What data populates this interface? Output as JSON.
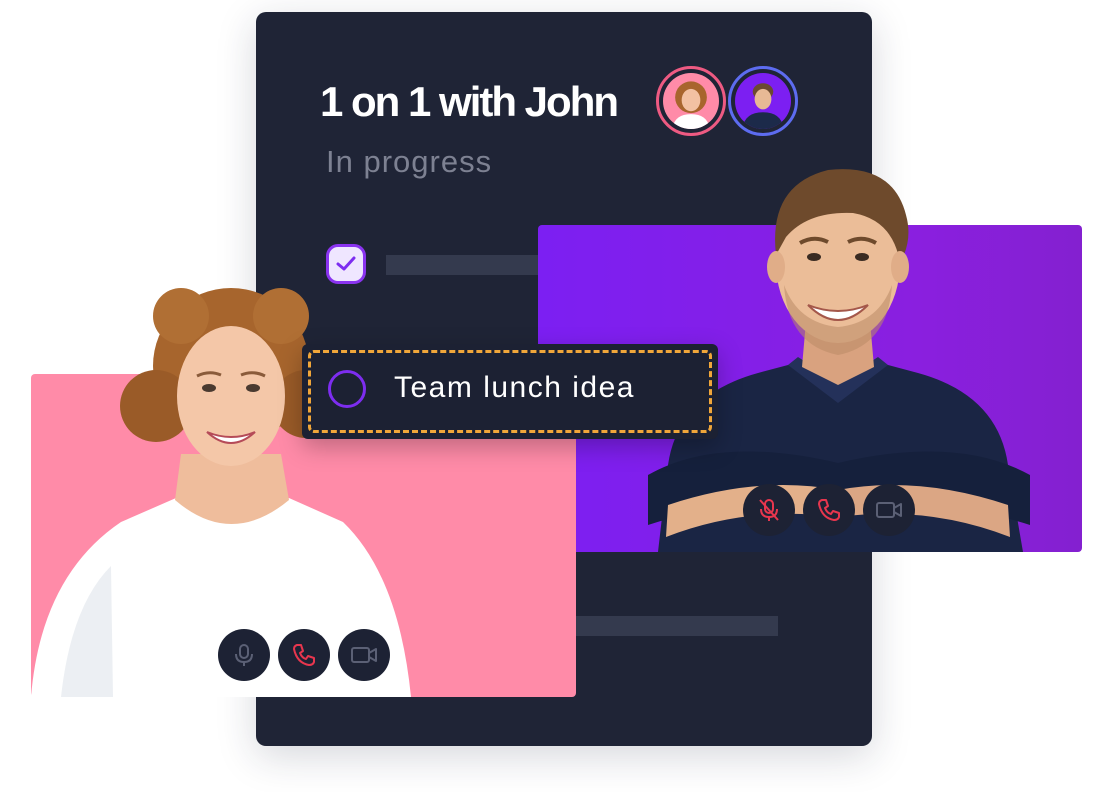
{
  "meeting": {
    "title": "1 on 1 with John",
    "status": "In progress",
    "participants": [
      "participant-woman",
      "participant-john"
    ]
  },
  "checklist": {
    "completed_item": {
      "checked": true
    },
    "active_task": {
      "label": "Team lunch idea",
      "checked": false
    }
  },
  "colors": {
    "card_bg": "#1f2436",
    "accent_purple": "#8a33f0",
    "accent_orange": "#f0a63a",
    "woman_tile_bg": "#ff8ba8",
    "john_tile_bg": "#7c1ff2",
    "hangup_red": "#e8364e"
  },
  "video_controls": {
    "woman": [
      "microphone-icon",
      "phone-hangup-icon",
      "video-camera-icon"
    ],
    "john": [
      "microphone-muted-icon",
      "phone-hangup-icon",
      "video-camera-icon"
    ]
  }
}
